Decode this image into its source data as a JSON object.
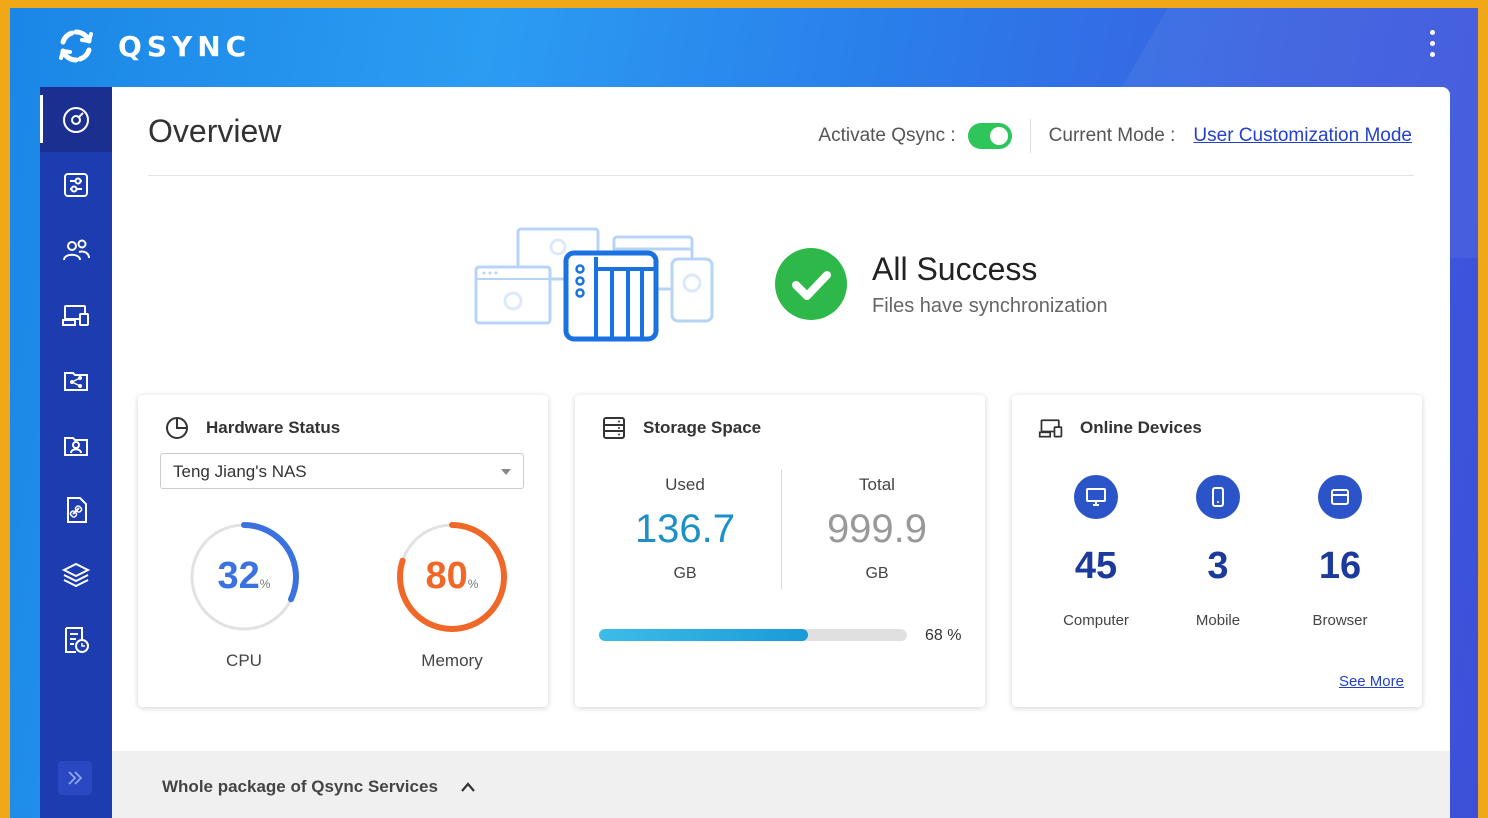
{
  "app": {
    "name": "QSYNC"
  },
  "header": {
    "page_title": "Overview",
    "activate_label": "Activate Qsync :",
    "activate_on": true,
    "mode_label": "Current Mode :",
    "mode_value": "User Customization Mode"
  },
  "sidebar": {
    "items": [
      {
        "icon": "overview-icon",
        "active": true
      },
      {
        "icon": "settings-sliders-icon",
        "active": false
      },
      {
        "icon": "users-icon",
        "active": false
      },
      {
        "icon": "devices-icon",
        "active": false
      },
      {
        "icon": "shared-folder-icon",
        "active": false
      },
      {
        "icon": "user-folder-icon",
        "active": false
      },
      {
        "icon": "link-file-icon",
        "active": false
      },
      {
        "icon": "layers-icon",
        "active": false
      },
      {
        "icon": "log-icon",
        "active": false
      }
    ],
    "expand_icon": "double-chevron-right-icon"
  },
  "status": {
    "title": "All Success",
    "subtitle": "Files have synchronization",
    "color": "#2eb84a"
  },
  "hardware": {
    "title": "Hardware Status",
    "nas_name": "Teng Jiang's NAS",
    "cpu": {
      "value": "32",
      "unit": "%",
      "label": "CPU",
      "fraction": 0.32,
      "color": "#3b72e0"
    },
    "memory": {
      "value": "80",
      "unit": "%",
      "label": "Memory",
      "fraction": 0.8,
      "color": "#f06828"
    }
  },
  "storage": {
    "title": "Storage Space",
    "used_label": "Used",
    "used_value": "136.7",
    "used_unit": "GB",
    "total_label": "Total",
    "total_value": "999.9",
    "total_unit": "GB",
    "percent_text": "68 %",
    "bar_fraction": 0.68
  },
  "devices": {
    "title": "Online Devices",
    "items": [
      {
        "label": "Computer",
        "count": "45",
        "icon": "monitor-icon"
      },
      {
        "label": "Mobile",
        "count": "3",
        "icon": "phone-icon"
      },
      {
        "label": "Browser",
        "count": "16",
        "icon": "browser-icon"
      }
    ],
    "see_more": "See More"
  },
  "footer": {
    "label": "Whole package of Qsync Services"
  }
}
